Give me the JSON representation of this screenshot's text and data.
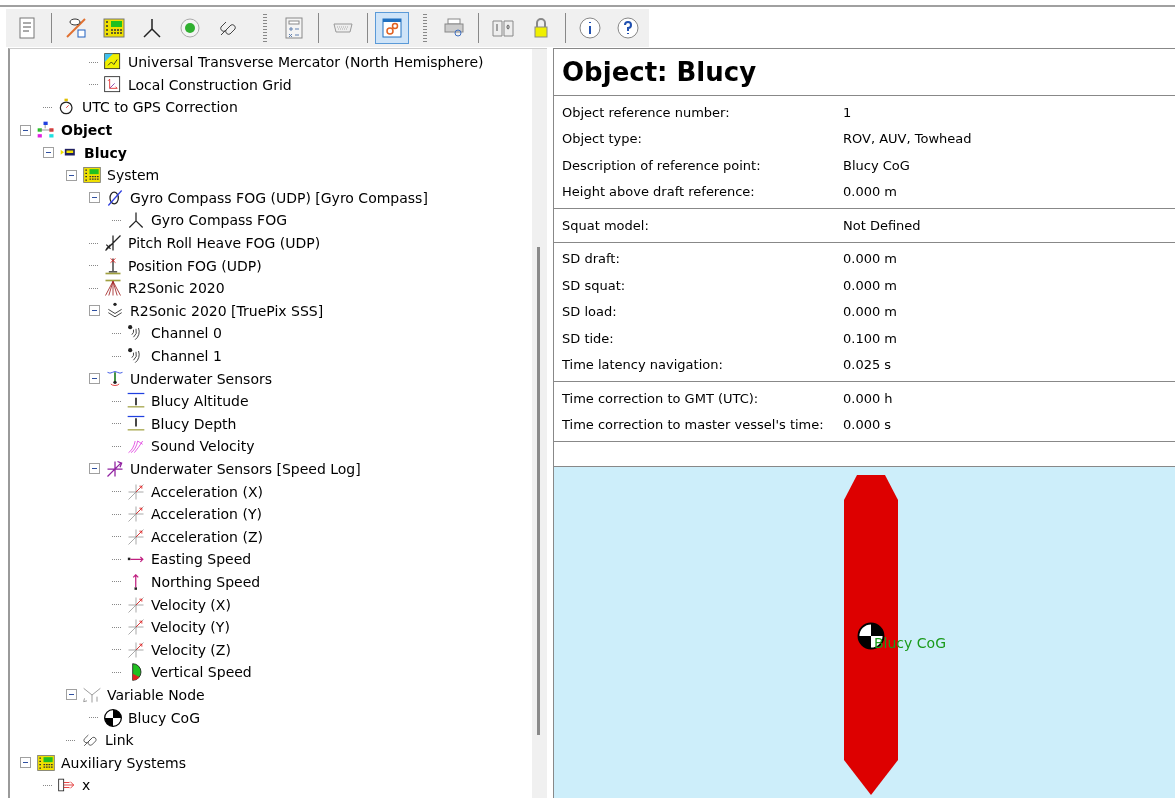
{
  "toolbar": [
    {
      "kind": "doc",
      "selected": false
    },
    {
      "kind": "sep"
    },
    {
      "kind": "hide",
      "selected": false
    },
    {
      "kind": "system",
      "selected": false
    },
    {
      "kind": "axes",
      "selected": false
    },
    {
      "kind": "record",
      "selected": false
    },
    {
      "kind": "link",
      "selected": false
    },
    {
      "kind": "gap"
    },
    {
      "kind": "grip"
    },
    {
      "kind": "calc",
      "selected": false
    },
    {
      "kind": "sep"
    },
    {
      "kind": "serial",
      "selected": false
    },
    {
      "kind": "sep"
    },
    {
      "kind": "settings",
      "selected": true
    },
    {
      "kind": "end"
    },
    {
      "kind": "grip"
    },
    {
      "kind": "print",
      "selected": false
    },
    {
      "kind": "sep"
    },
    {
      "kind": "book",
      "selected": false
    },
    {
      "kind": "lock",
      "selected": false
    },
    {
      "kind": "sep"
    },
    {
      "kind": "info",
      "selected": false
    },
    {
      "kind": "help",
      "selected": false
    },
    {
      "kind": "end"
    }
  ],
  "tree": [
    {
      "children": [
        {
          "children": [
            {
              "children": [
                {
                  "label": "Universal Transverse Mercator (North Hemisphere)",
                  "kind": "projection"
                },
                {
                  "label": "Local Construction Grid",
                  "kind": "grid"
                }
              ]
            }
          ]
        },
        {
          "label": "UTC to GPS Correction",
          "kind": "timer"
        }
      ]
    },
    {
      "label": "Object",
      "kind": "object",
      "bold": true,
      "expanded": true,
      "children": [
        {
          "label": "Blucy",
          "kind": "vehicle",
          "bold": true,
          "expanded": true,
          "children": [
            {
              "label": "System",
              "kind": "system",
              "expanded": true,
              "children": [
                {
                  "label": "Gyro Compass FOG (UDP) [Gyro Compass]",
                  "kind": "gyro",
                  "expanded": true,
                  "children": [
                    {
                      "label": "Gyro Compass FOG",
                      "kind": "axes"
                    }
                  ]
                },
                {
                  "label": "Pitch Roll Heave FOG (UDP)",
                  "kind": "pitch"
                },
                {
                  "label": "Position FOG (UDP)",
                  "kind": "position"
                },
                {
                  "label": "R2Sonic 2020",
                  "kind": "multibeam"
                },
                {
                  "label": "R2Sonic 2020 [TruePix SSS]",
                  "kind": "sonar",
                  "expanded": true,
                  "children": [
                    {
                      "label": "Channel 0",
                      "kind": "channel"
                    },
                    {
                      "label": "Channel 1",
                      "kind": "channel"
                    }
                  ]
                },
                {
                  "label": "Underwater Sensors",
                  "kind": "sensors",
                  "expanded": true,
                  "children": [
                    {
                      "label": "Blucy Altitude",
                      "kind": "altitude"
                    },
                    {
                      "label": "Blucy Depth",
                      "kind": "depth"
                    },
                    {
                      "label": "Sound Velocity",
                      "kind": "svp"
                    }
                  ]
                },
                {
                  "label": "Underwater Sensors [Speed Log]",
                  "kind": "speedlog",
                  "expanded": true,
                  "children": [
                    {
                      "label": "Acceleration (X)",
                      "kind": "vector"
                    },
                    {
                      "label": "Acceleration (Y)",
                      "kind": "vector"
                    },
                    {
                      "label": "Acceleration (Z)",
                      "kind": "vector"
                    },
                    {
                      "label": "Easting Speed",
                      "kind": "easting"
                    },
                    {
                      "label": "Northing Speed",
                      "kind": "northing"
                    },
                    {
                      "label": "Velocity (X)",
                      "kind": "vector"
                    },
                    {
                      "label": "Velocity (Y)",
                      "kind": "vector"
                    },
                    {
                      "label": "Velocity (Z)",
                      "kind": "vector"
                    },
                    {
                      "label": "Vertical Speed",
                      "kind": "vertical"
                    }
                  ]
                }
              ]
            },
            {
              "label": "Variable Node",
              "kind": "node",
              "expanded": true,
              "children": [
                {
                  "label": "Blucy CoG",
                  "kind": "cog"
                }
              ]
            },
            {
              "label": "Link",
              "kind": "link"
            }
          ]
        }
      ]
    },
    {
      "label": "Auxiliary Systems",
      "kind": "system",
      "expanded": true,
      "children": [
        {
          "label": "x",
          "kind": "output"
        }
      ]
    }
  ],
  "panel": {
    "title": "Object: Blucy",
    "groups": [
      [
        {
          "label": "Object reference number:",
          "value": "1"
        },
        {
          "label": "Object type:",
          "value": "ROV, AUV, Towhead"
        },
        {
          "label": "Description of reference point:",
          "value": "Blucy CoG"
        },
        {
          "label": "Height above draft reference:",
          "value": "0.000 m"
        }
      ],
      [
        {
          "label": "Squat model:",
          "value": "Not Defined"
        }
      ],
      [
        {
          "label": "SD draft:",
          "value": "0.000 m"
        },
        {
          "label": "SD squat:",
          "value": "0.000 m"
        },
        {
          "label": "SD load:",
          "value": "0.000 m"
        },
        {
          "label": "SD tide:",
          "value": "0.100 m"
        },
        {
          "label": "Time latency navigation:",
          "value": "0.025 s"
        }
      ],
      [
        {
          "label": "Time correction to GMT (UTC):",
          "value": "0.000 h"
        },
        {
          "label": "Time correction to master vessel's time:",
          "value": "0.000 s"
        }
      ]
    ],
    "drawing": {
      "point_label": "Blucy CoG"
    }
  }
}
